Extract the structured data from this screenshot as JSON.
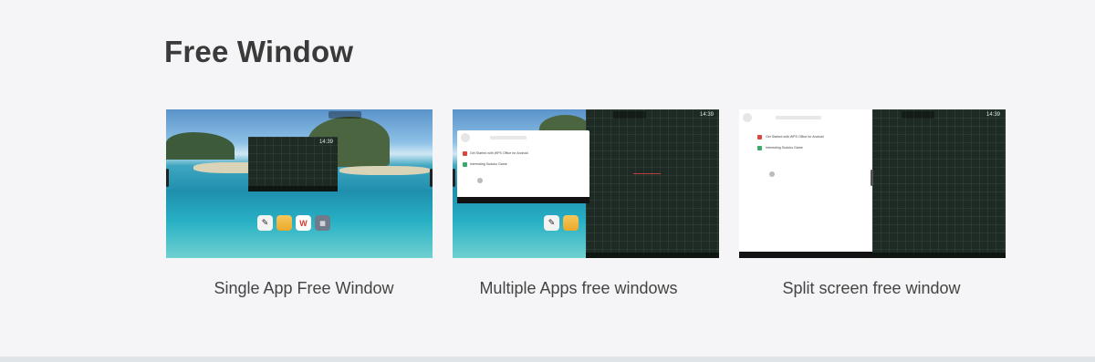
{
  "section": {
    "title": "Free Window"
  },
  "cards": [
    {
      "caption": "Single App Free Window",
      "screen": {
        "clock": "14:39",
        "dock_apps": [
          {
            "icon": "pen-icon",
            "glyph": "✎"
          },
          {
            "icon": "folder-icon",
            "glyph": ""
          },
          {
            "icon": "wps-icon",
            "glyph": "W"
          },
          {
            "icon": "apps-grid-icon",
            "glyph": "▦"
          }
        ]
      }
    },
    {
      "caption": "Multiple Apps free windows",
      "screen": {
        "clock": "14:39",
        "panel_items": [
          "Get Started with WPS Office for Android",
          "Interesting Sudoku Game"
        ]
      }
    },
    {
      "caption": "Split screen free window",
      "screen": {
        "clock": "14:39",
        "panel_items": [
          "Get Started with WPS Office for Android",
          "Interesting Sudoku Game"
        ]
      }
    }
  ]
}
